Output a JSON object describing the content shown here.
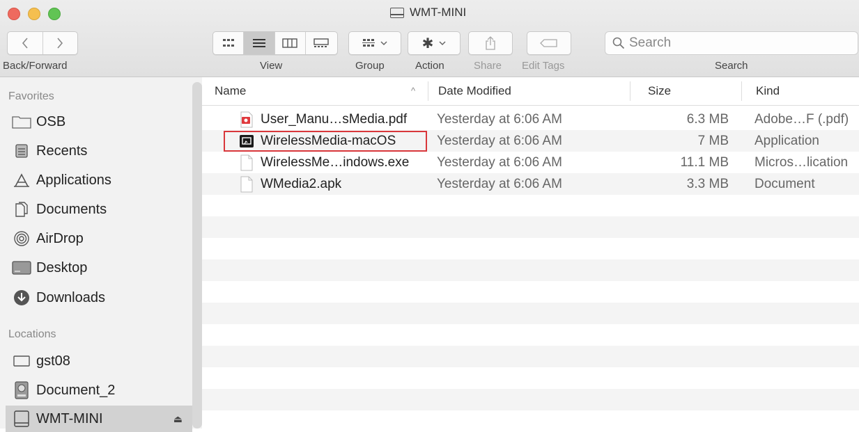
{
  "window": {
    "title": "WMT-MINI"
  },
  "toolbar": {
    "back_forward_label": "Back/Forward",
    "view_label": "View",
    "group_label": "Group",
    "action_label": "Action",
    "share_label": "Share",
    "edit_tags_label": "Edit Tags",
    "search_label": "Search",
    "search_placeholder": "Search"
  },
  "sidebar": {
    "favorites_header": "Favorites",
    "favorites": [
      {
        "label": "OSB",
        "icon": "folder-icon"
      },
      {
        "label": "Recents",
        "icon": "recents-icon"
      },
      {
        "label": "Applications",
        "icon": "applications-icon"
      },
      {
        "label": "Documents",
        "icon": "documents-icon"
      },
      {
        "label": "AirDrop",
        "icon": "airdrop-icon"
      },
      {
        "label": "Desktop",
        "icon": "desktop-icon"
      },
      {
        "label": "Downloads",
        "icon": "downloads-icon"
      }
    ],
    "locations_header": "Locations",
    "locations": [
      {
        "label": "gst08",
        "icon": "computer-icon"
      },
      {
        "label": "Document_2",
        "icon": "disk-icon"
      },
      {
        "label": "WMT-MINI",
        "icon": "external-drive-icon",
        "selected": true,
        "eject": "⏏"
      }
    ]
  },
  "list": {
    "columns": {
      "name": "Name",
      "date": "Date Modified",
      "size": "Size",
      "kind": "Kind"
    },
    "sort_indicator": "^",
    "files": [
      {
        "name": "User_Manu…sMedia.pdf",
        "date": "Yesterday at 6:06 AM",
        "size": "6.3 MB",
        "kind": "Adobe…F (.pdf)",
        "icon": "pdf-icon"
      },
      {
        "name": "WirelessMedia-macOS",
        "date": "Yesterday at 6:06 AM",
        "size": "7 MB",
        "kind": "Application",
        "icon": "app-icon",
        "highlighted": true
      },
      {
        "name": "WirelessMe…indows.exe",
        "date": "Yesterday at 6:06 AM",
        "size": "11.1 MB",
        "kind": "Micros…lication",
        "icon": "exe-icon"
      },
      {
        "name": "WMedia2.apk",
        "date": "Yesterday at 6:06 AM",
        "size": "3.3 MB",
        "kind": "Document",
        "icon": "document-icon"
      }
    ]
  },
  "colors": {
    "highlight_border": "#d9373b",
    "alt_row": "#f4f4f4",
    "sidebar_bg": "#f2f2f2"
  }
}
